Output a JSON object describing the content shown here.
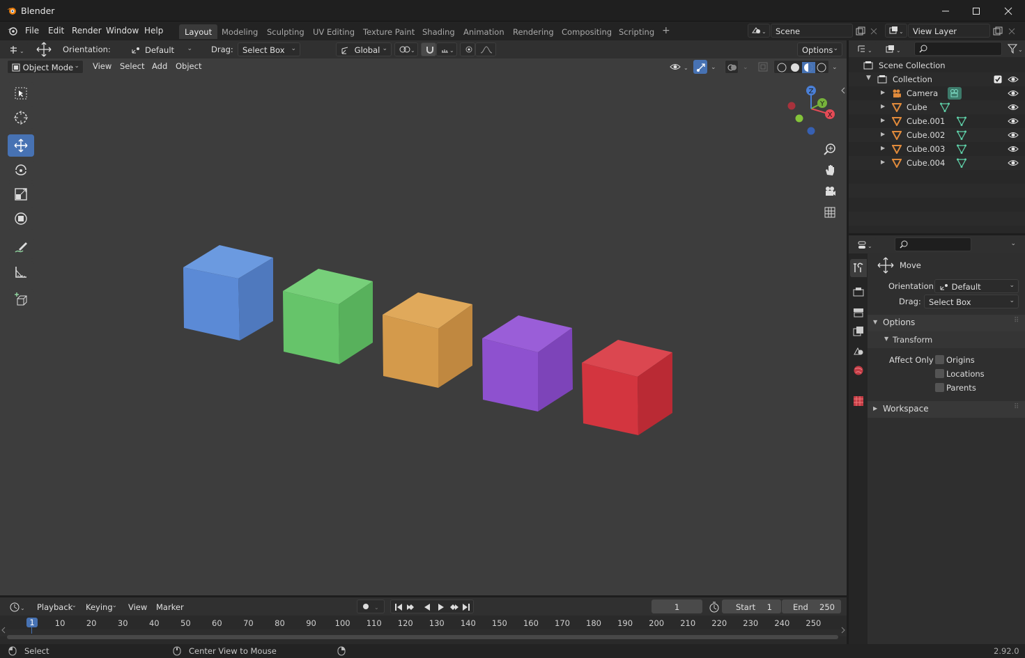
{
  "window": {
    "title": "Blender"
  },
  "menubar": {
    "items": [
      "File",
      "Edit",
      "Render",
      "Window",
      "Help"
    ]
  },
  "workspaces": {
    "tabs": [
      "Layout",
      "Modeling",
      "Sculpting",
      "UV Editing",
      "Texture Paint",
      "Shading",
      "Animation",
      "Rendering",
      "Compositing",
      "Scripting"
    ],
    "active": "Layout",
    "add_symbol": "+"
  },
  "scene": {
    "name": "Scene"
  },
  "view_layer": {
    "name": "View Layer"
  },
  "tool_settings": {
    "orientation_label": "Orientation:",
    "orientation_value": "Default",
    "drag_label": "Drag:",
    "drag_value": "Select Box",
    "transform_orientation": "Global",
    "options_label": "Options"
  },
  "viewport_header": {
    "mode": "Object Mode",
    "menus": [
      "View",
      "Select",
      "Add",
      "Object"
    ]
  },
  "gizmo": {
    "x": "X",
    "y": "Y",
    "z": "Z"
  },
  "cubes": [
    {
      "color": "#5b8ad6"
    },
    {
      "color": "#66c46a"
    },
    {
      "color": "#d49a4b"
    },
    {
      "color": "#8e51cf"
    },
    {
      "color": "#d3353f"
    }
  ],
  "outliner": {
    "root": "Scene Collection",
    "collection": "Collection",
    "objects": [
      {
        "name": "Camera",
        "type": "camera"
      },
      {
        "name": "Cube",
        "type": "mesh"
      },
      {
        "name": "Cube.001",
        "type": "mesh"
      },
      {
        "name": "Cube.002",
        "type": "mesh"
      },
      {
        "name": "Cube.003",
        "type": "mesh"
      },
      {
        "name": "Cube.004",
        "type": "mesh"
      }
    ]
  },
  "properties": {
    "tool_name": "Move",
    "orientation_label": "Orientation",
    "orientation_value": "Default",
    "drag_label": "Drag:",
    "drag_value": "Select Box",
    "options_panel": "Options",
    "transform_subpanel": "Transform",
    "affect_only_label": "Affect Only",
    "affect_only": [
      {
        "label": "Origins",
        "checked": false
      },
      {
        "label": "Locations",
        "checked": false
      },
      {
        "label": "Parents",
        "checked": false
      }
    ],
    "workspace_panel": "Workspace"
  },
  "timeline": {
    "menus": [
      "Playback",
      "Keying",
      "View",
      "Marker"
    ],
    "current_frame": "1",
    "start_label": "Start",
    "start_value": "1",
    "end_label": "End",
    "end_value": "250",
    "ruler": [
      "1",
      "10",
      "20",
      "30",
      "40",
      "50",
      "60",
      "70",
      "80",
      "90",
      "100",
      "110",
      "120",
      "130",
      "140",
      "150",
      "160",
      "170",
      "180",
      "190",
      "200",
      "210",
      "220",
      "230",
      "240",
      "250"
    ]
  },
  "statusbar": {
    "left_action": "Select",
    "middle_action": "Center View to Mouse",
    "version": "2.92.0"
  }
}
